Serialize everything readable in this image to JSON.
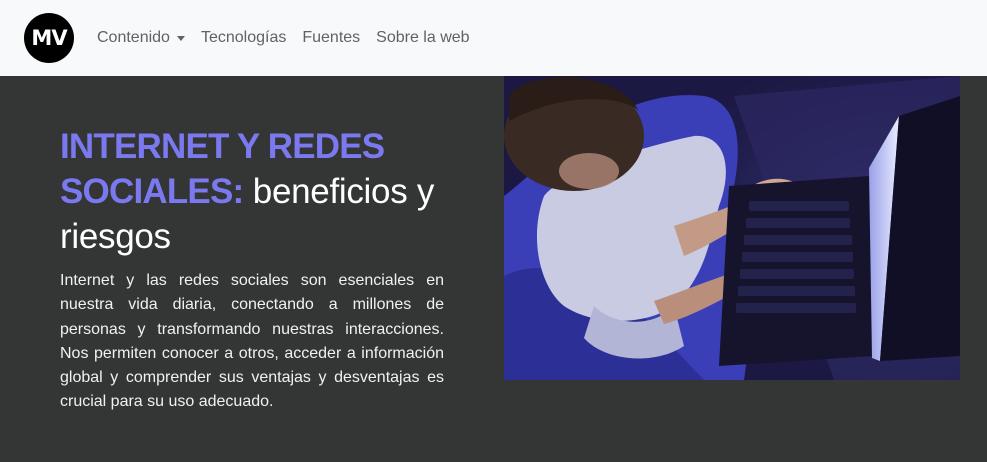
{
  "navbar": {
    "logo_text": "MV",
    "items": [
      {
        "label": "Contenido",
        "has_dropdown": true
      },
      {
        "label": "Tecnologías"
      },
      {
        "label": "Fuentes"
      },
      {
        "label": "Sobre la web"
      }
    ]
  },
  "hero": {
    "title_accent": "INTERNET Y REDES SOCIALES:",
    "title_rest": " beneficios y riesgos",
    "description": "Internet y las redes sociales son esenciales en nuestra vida diaria, conectando a millones de personas y transformando nuestras interacciones. Nos permiten conocer a otros, acceder a información global y comprender sus ventajas y desventajas es crucial para su uso adecuado."
  },
  "colors": {
    "accent": "#7b79f0",
    "background": "#343535",
    "navbar": "#f8f9fa"
  }
}
